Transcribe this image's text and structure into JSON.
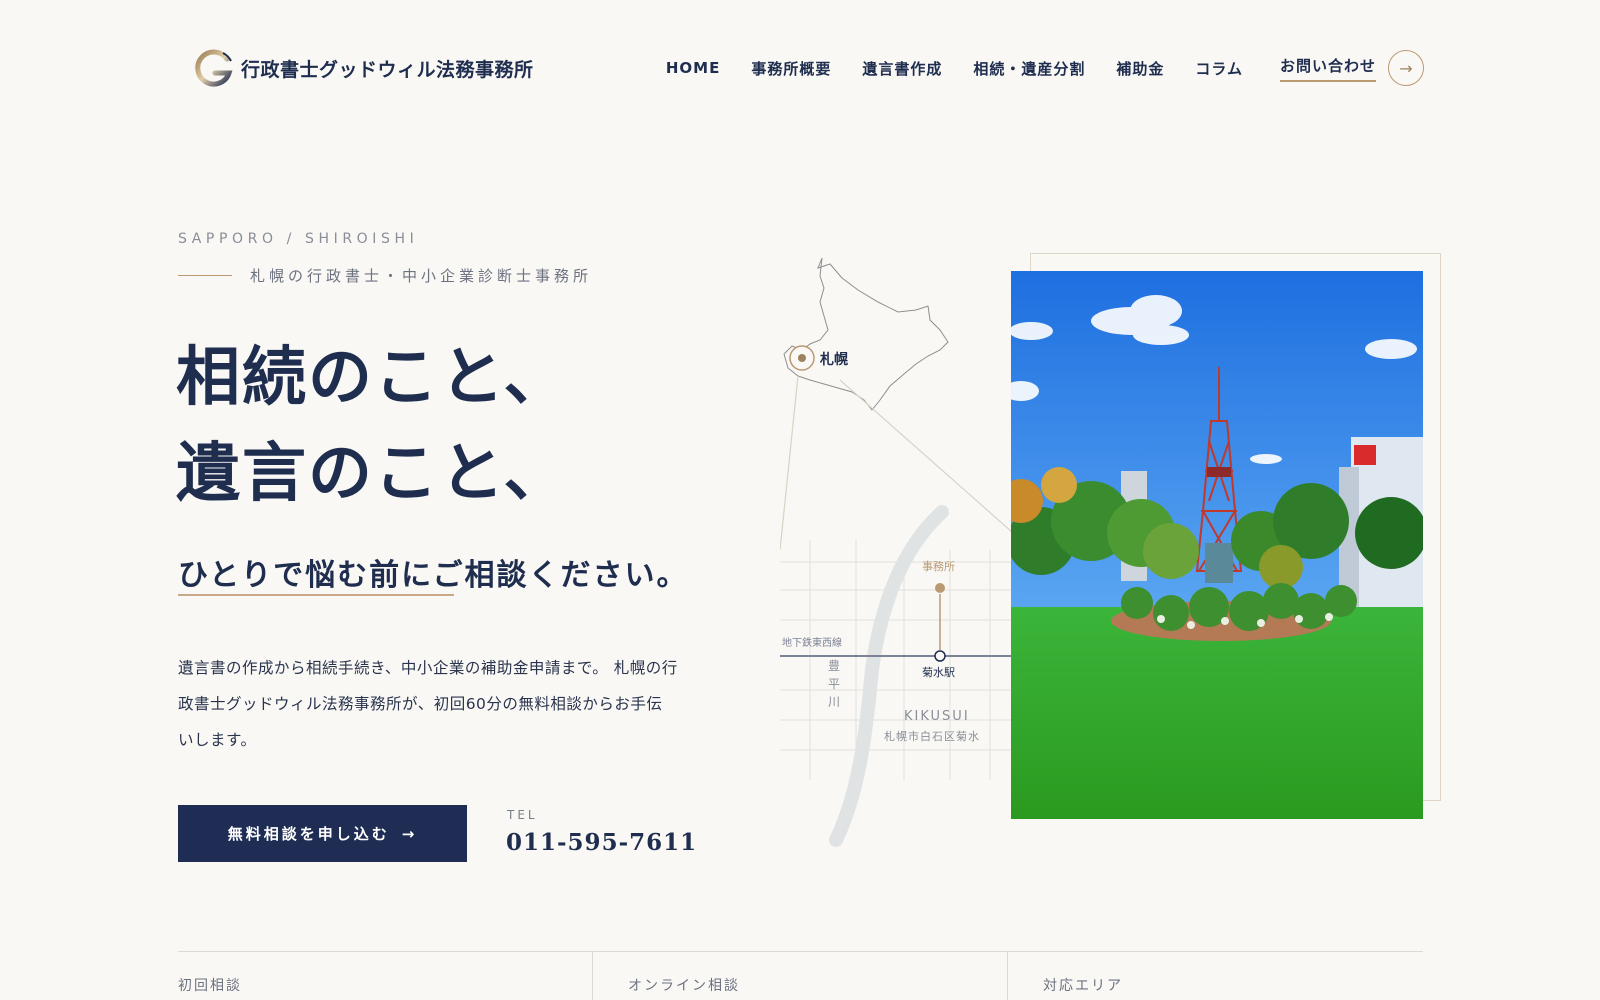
{
  "header": {
    "logo_text": "行政書士グッドウィル法務事務所",
    "nav": [
      {
        "label": "HOME"
      },
      {
        "label": "事務所概要"
      },
      {
        "label": "遺言書作成"
      },
      {
        "label": "相続・遺産分割"
      },
      {
        "label": "補助金"
      },
      {
        "label": "コラム"
      }
    ],
    "contact_label": "お問い合わせ",
    "contact_arrow": "→"
  },
  "hero": {
    "eyebrow": "SAPPORO / SHIROISHI",
    "subtitle": "札幌の行政書士・中小企業診断士事務所",
    "headline_line1": "相続のこと、",
    "headline_line2": "遺言のこと、",
    "tagline": "ひとりで悩む前にご相談ください。",
    "lead": "遺言書の作成から相続手続き、中小企業の補助金申請まで。 札幌の行政書士グッドウィル法務事務所が、初回60分の無料相談からお手伝いします。",
    "cta_label": "無料相談を申し込む",
    "cta_arrow": "→",
    "tel_label": "TEL",
    "tel_number": "011-595-7611"
  },
  "map": {
    "city_label": "札幌",
    "office_label": "事務所",
    "line_label": "地下鉄東西線",
    "river_label_1": "豊",
    "river_label_2": "平",
    "river_label_3": "川",
    "station_label": "菊水駅",
    "area_en": "KIKUSUI",
    "area_jp": "札幌市白石区菊水"
  },
  "info": {
    "items": [
      {
        "label": "初回相談"
      },
      {
        "label": "オンライン相談"
      },
      {
        "label": "対応エリア"
      }
    ]
  },
  "colors": {
    "navy": "#1f2d55",
    "gold": "#b99a73",
    "background": "#f9f8f5"
  }
}
